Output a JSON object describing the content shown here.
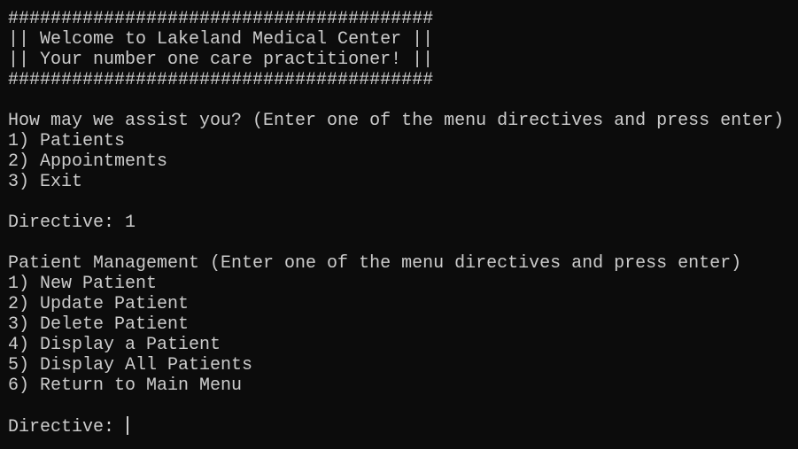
{
  "banner": {
    "border": "########################################",
    "line1": "|| Welcome to Lakeland Medical Center ||",
    "line2": "|| Your number one care practitioner! ||"
  },
  "main_menu": {
    "prompt": "How may we assist you? (Enter one of the menu directives and press enter)",
    "items": [
      "1) Patients",
      "2) Appointments",
      "3) Exit"
    ],
    "directive_label": "Directive: ",
    "directive_value": "1"
  },
  "patient_menu": {
    "prompt": "Patient Management (Enter one of the menu directives and press enter)",
    "items": [
      "1) New Patient",
      "2) Update Patient",
      "3) Delete Patient",
      "4) Display a Patient",
      "5) Display All Patients",
      "6) Return to Main Menu"
    ],
    "directive_label": "Directive: ",
    "directive_value": ""
  },
  "colors": {
    "background": "#0c0c0c",
    "text": "#cccccc"
  }
}
